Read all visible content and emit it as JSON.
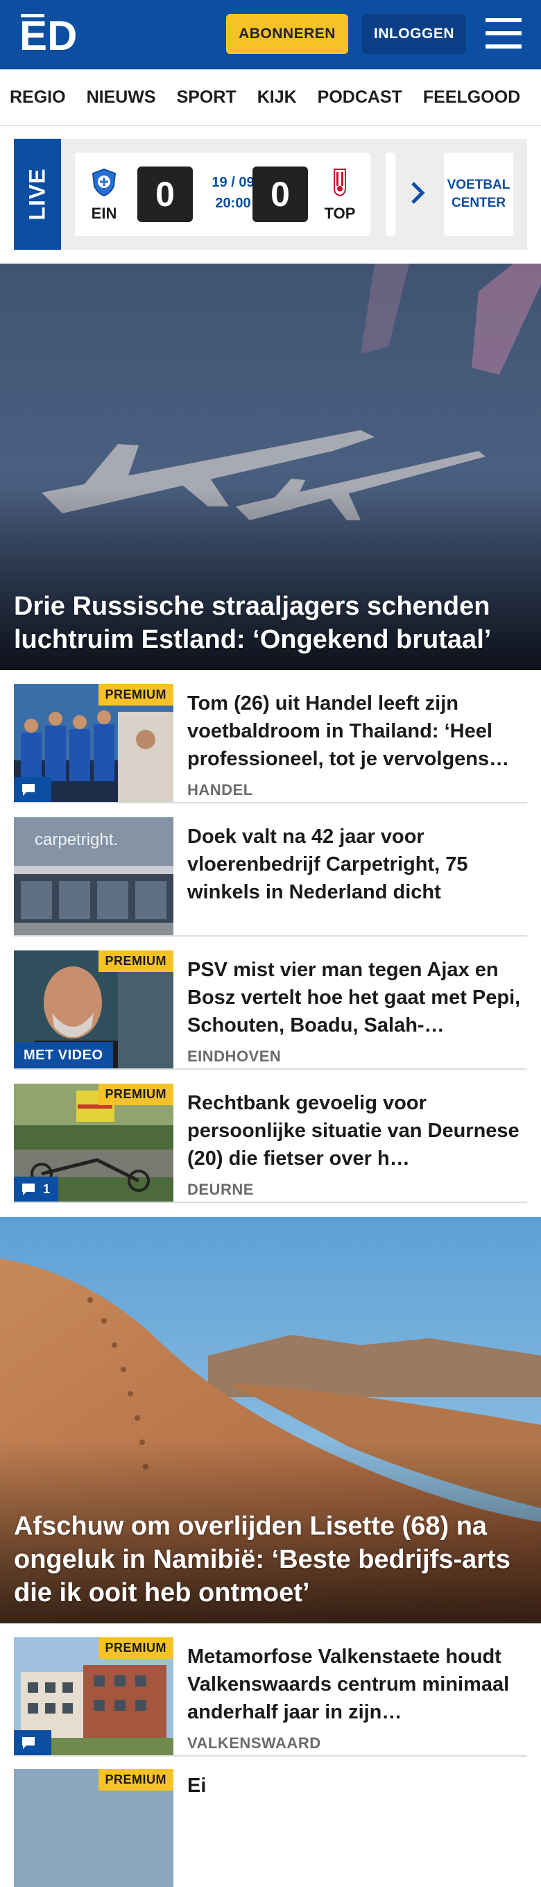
{
  "header": {
    "logo_text": "ED",
    "subscribe_label": "ABONNEREN",
    "login_label": "INLOGGEN",
    "menu_icon": "hamburger-menu-icon",
    "brand_color": "#0b4ea2",
    "accent_color": "#f6c227"
  },
  "nav": {
    "items": [
      "REGIO",
      "NIEUWS",
      "SPORT",
      "KIJK",
      "PODCAST",
      "FEELGOOD"
    ]
  },
  "live": {
    "label": "LIVE",
    "match": {
      "home_team": "EIN",
      "away_team": "TOP",
      "home_score": "0",
      "away_score": "0",
      "date": "19 / 09",
      "time": "20:00"
    },
    "center_label": "VOETBAL CENTER"
  },
  "hero1": {
    "title": "Drie Russische straaljagers schenden luchtruim Estland: ‘Ongekend brutaal’"
  },
  "articles": [
    {
      "title": "Tom (26) uit Handel leeft zijn voetbaldroom in Thailand: ‘Heel professioneel, tot je vervolgens…",
      "location": "HANDEL",
      "premium": "PREMIUM",
      "comments": ""
    },
    {
      "title": "Doek valt na 42 jaar voor vloerenbedrijf Carpetright, 75 winkels in Nederland dicht",
      "location": "",
      "store_sign": "carpetright."
    },
    {
      "title": "PSV mist vier man tegen Ajax en Bosz vertelt hoe het gaat met Pepi, Schouten, Boadu, Salah-…",
      "location": "EINDHOVEN",
      "premium": "PREMIUM",
      "video": "MET VIDEO"
    },
    {
      "title": "Rechtbank gevoelig voor persoonlijke situatie van Deurnese (20) die fietser over h…",
      "location": "DEURNE",
      "premium": "PREMIUM",
      "comments": "1"
    }
  ],
  "hero2": {
    "title": "Afschuw om overlijden Lisette (68) na ongeluk in Namibië: ‘Beste bedrijfs-arts die ik ooit heb ontmoet’"
  },
  "articles2": [
    {
      "title": "Metamorfose Valkenstaete houdt Valkenswaards centrum minimaal anderhalf jaar in zijn…",
      "location": "VALKENSWAARD",
      "premium": "PREMIUM",
      "comments": ""
    },
    {
      "title": "Ei",
      "premium": "PREMIUM"
    }
  ]
}
